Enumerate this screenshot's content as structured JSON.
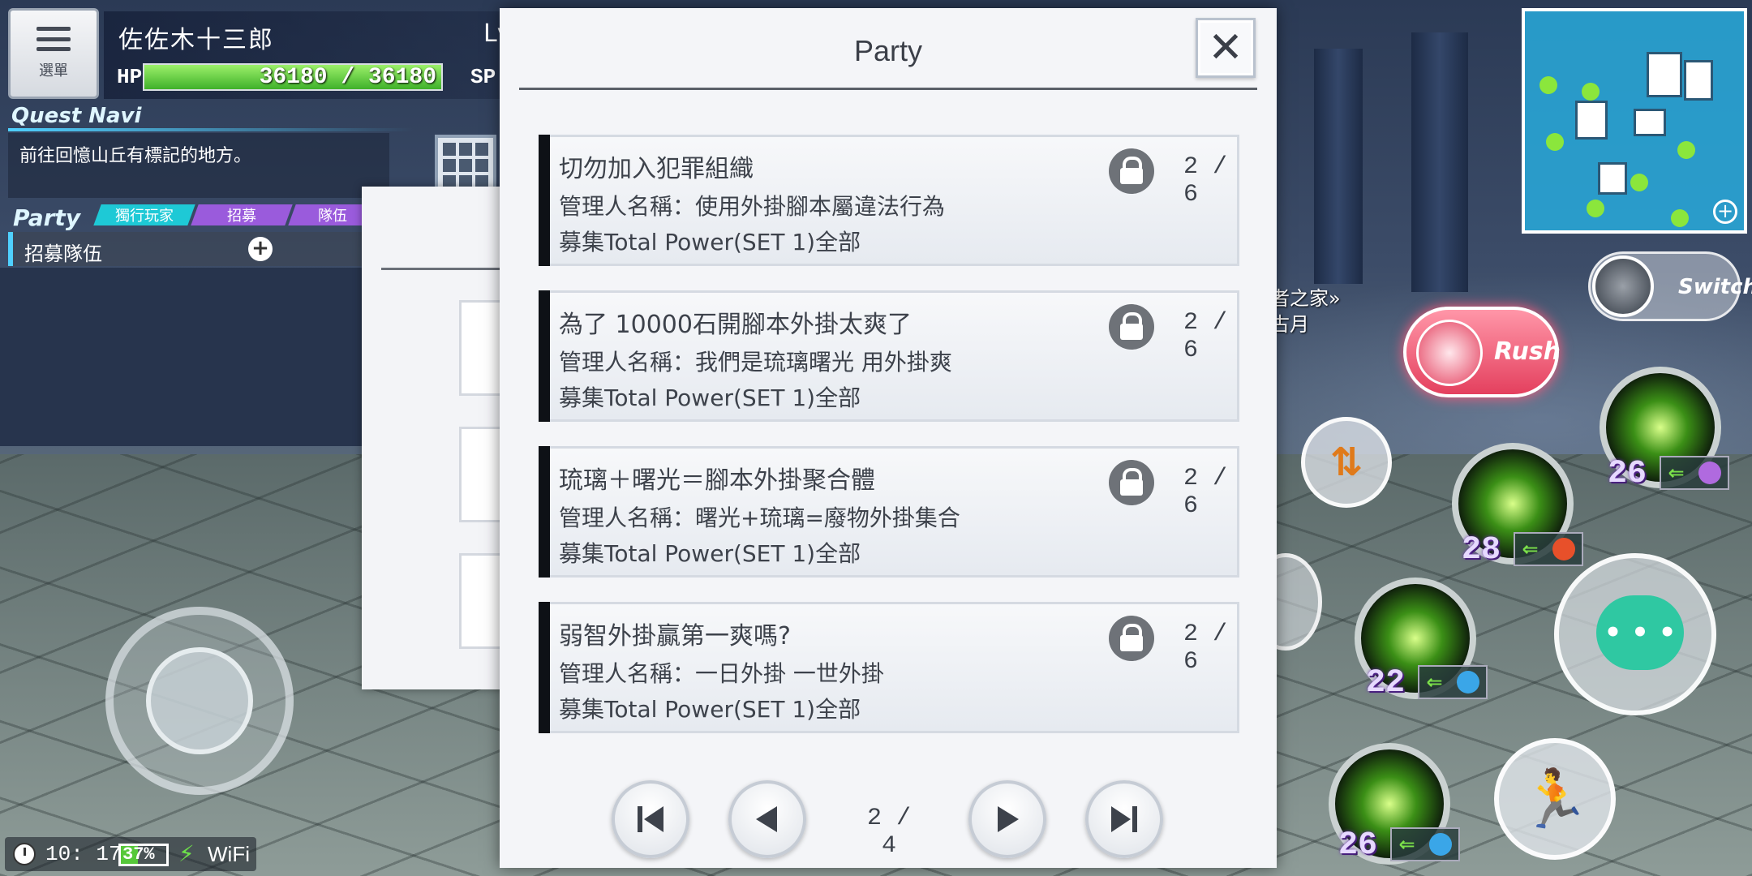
{
  "hud": {
    "menu_label": "選單",
    "player_name": "佐佐木十三郎",
    "level_prefix": "Lv",
    "hp_label": "HP",
    "hp_value": "36180 / 36180",
    "hp_fraction": 1.0,
    "sp_label": "SP",
    "quest_title": "Quest Navi",
    "quest_text": "前往回憶山丘有標記的地方。",
    "party_title": "Party",
    "party_tabs": [
      "獨行玩家",
      "招募",
      "隊伍"
    ],
    "recruit_label": "招募隊伍",
    "recruit_plus": "+"
  },
  "status": {
    "time": "10: 17",
    "battery": "37%",
    "battery_fraction": 0.37,
    "network": "WiFi"
  },
  "dialog": {
    "title": "Party",
    "close_label": "✕",
    "entries": [
      {
        "title": "切勿加入犯罪組織",
        "admin": "管理人名稱：使用外掛腳本屬違法行為",
        "recruit": "募集Total Power(SET 1)全部",
        "count": "2 / 6"
      },
      {
        "title": "為了 10000石開腳本外掛太爽了",
        "admin": "管理人名稱：我們是琉璃曙光 用外掛爽",
        "recruit": "募集Total Power(SET 1)全部",
        "count": "2 / 6"
      },
      {
        "title": "琉璃＋曙光＝腳本外掛聚合體",
        "admin": "管理人名稱：曙光+琉璃=廢物外掛集合",
        "recruit": "募集Total Power(SET 1)全部",
        "count": "2 / 6"
      },
      {
        "title": "弱智外掛贏第一爽嗎?",
        "admin": "管理人名稱：一日外掛 一世外掛",
        "recruit": "募集Total Power(SET 1)全部",
        "count": "2 / 6"
      }
    ],
    "page_indicator": "2 / 4"
  },
  "world": {
    "npc_label": "者之家»",
    "npc_sub": "古月"
  },
  "combat": {
    "switch_label": "Switch",
    "rush_label": "Rush",
    "skills": [
      {
        "level": "26",
        "element_color": "#b06adf"
      },
      {
        "level": "28",
        "element_color": "#e8502a"
      },
      {
        "level": "22",
        "element_color": "#3aa6e8"
      },
      {
        "level": "26",
        "element_color": "#3aa6e8"
      }
    ]
  }
}
